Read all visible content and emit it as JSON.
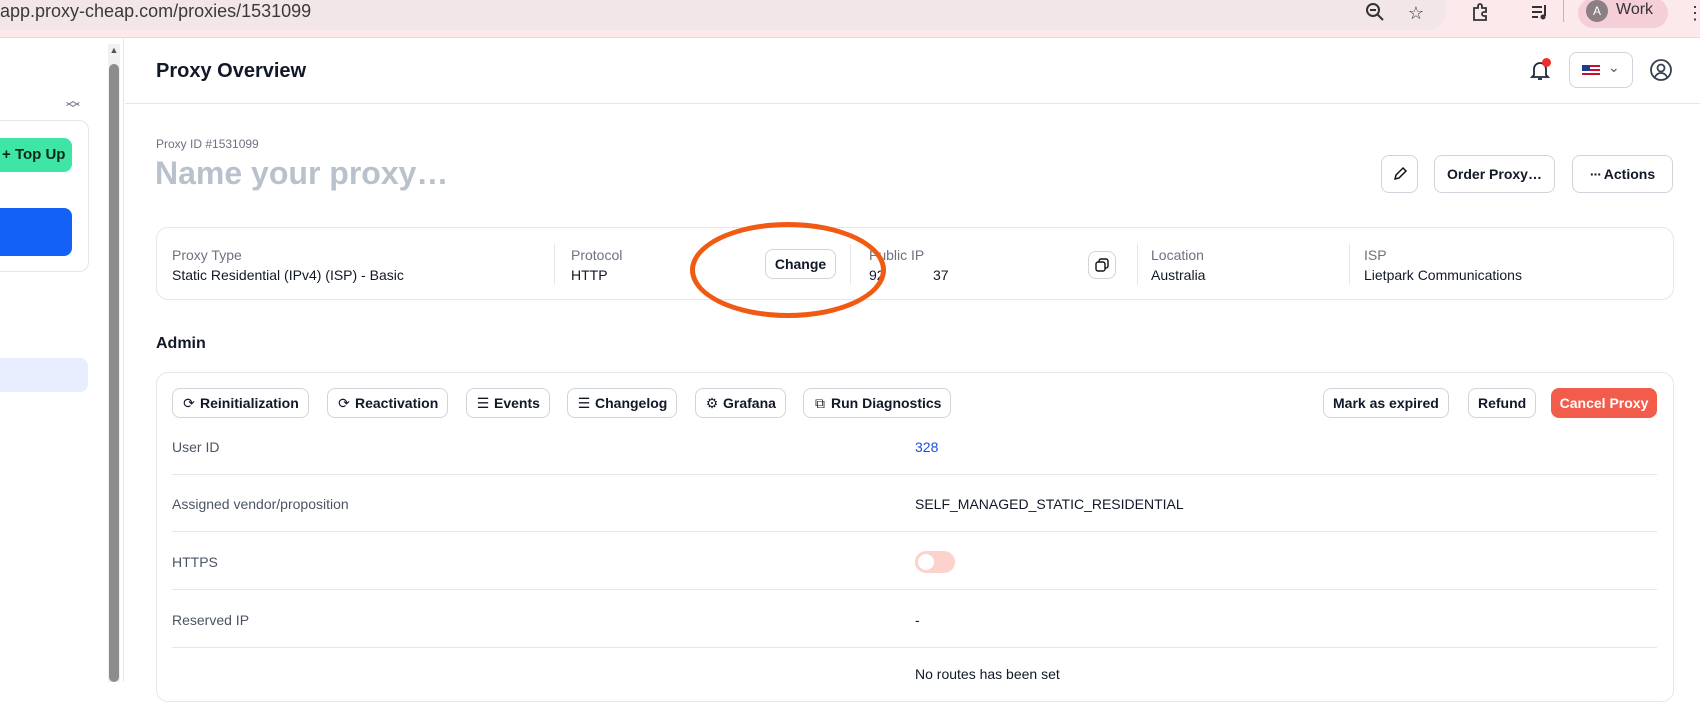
{
  "browser": {
    "url": "app.proxy-cheap.com/proxies/1531099",
    "profile_initial": "A",
    "profile_name": "Work"
  },
  "sidebar": {
    "topup_label": "Top Up"
  },
  "header": {
    "title": "Proxy Overview"
  },
  "proxy": {
    "id_label": "Proxy ID #1531099",
    "name_placeholder": "Name your proxy…",
    "order_label": "Order Proxy…",
    "actions_label": "Actions"
  },
  "info": {
    "type_label": "Proxy Type",
    "type_value": "Static Residential (IPv4) (ISP) - Basic",
    "protocol_label": "Protocol",
    "protocol_value": "HTTP",
    "change_label": "Change",
    "ip_label": "Public IP",
    "ip_value_start": "92",
    "ip_value_end": "37",
    "location_label": "Location",
    "location_value": "Australia",
    "isp_label": "ISP",
    "isp_value": "Lietpark Communications"
  },
  "admin": {
    "title": "Admin",
    "buttons": {
      "reinit": "Reinitialization",
      "reactivation": "Reactivation",
      "events": "Events",
      "changelog": "Changelog",
      "grafana": "Grafana",
      "diagnostics": "Run Diagnostics",
      "expired": "Mark as expired",
      "refund": "Refund",
      "cancel": "Cancel Proxy"
    },
    "rows": [
      {
        "label": "User ID",
        "value": "328"
      },
      {
        "label": "Assigned vendor/proposition",
        "value": "SELF_MANAGED_STATIC_RESIDENTIAL"
      },
      {
        "label": "HTTPS",
        "value": ""
      },
      {
        "label": "Reserved IP",
        "value": "-"
      },
      {
        "label": "",
        "value": "No routes has been set"
      }
    ]
  },
  "colors": {
    "accent_green": "#3ee5a4",
    "accent_blue": "#1462f5",
    "danger": "#f25c4b",
    "highlight_circle": "#f05a12"
  },
  "icons": [
    "zoom-out-icon",
    "star-icon",
    "extension-icon",
    "media-icon",
    "bell-icon",
    "flag-us-icon",
    "account-icon",
    "pencil-icon",
    "dots-icon",
    "copy-icon",
    "refresh-icon",
    "list-icon",
    "grafana-icon"
  ]
}
